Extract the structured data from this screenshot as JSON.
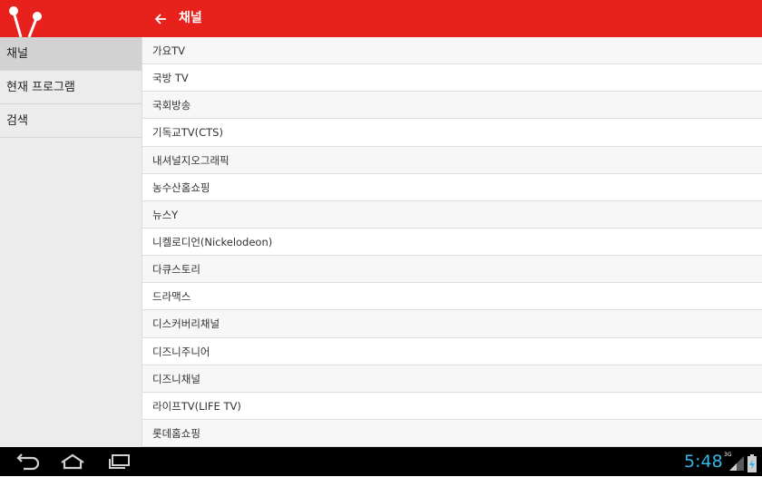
{
  "header": {
    "title": "채널",
    "back_icon": "arrow-left-icon",
    "logo_icon": "app-logo-icon"
  },
  "sidebar": {
    "items": [
      {
        "label": "채널",
        "active": true
      },
      {
        "label": "현재 프로그램",
        "active": false
      },
      {
        "label": "검색",
        "active": false
      }
    ]
  },
  "channels": [
    "가요TV",
    "국방 TV",
    "국회방송",
    "기독교TV(CTS)",
    "내셔널지오그래픽",
    "농수산홈쇼핑",
    "뉴스Y",
    "니켈로디언(Nickelodeon)",
    "다큐스토리",
    "드라맥스",
    "디스커버리채널",
    "디즈니주니어",
    "디즈니채널",
    "라이프TV(LIFE TV)",
    "롯데홈쇼핑"
  ],
  "system_bar": {
    "time": "5:48",
    "network_label": "3G",
    "icons": [
      "back-nav-icon",
      "home-nav-icon",
      "recents-nav-icon",
      "signal-icon",
      "battery-icon"
    ]
  },
  "colors": {
    "accent": "#e8211d",
    "clock": "#33b5e5",
    "sidebar_bg": "#ececec",
    "sidebar_active": "#d2d2d2"
  }
}
